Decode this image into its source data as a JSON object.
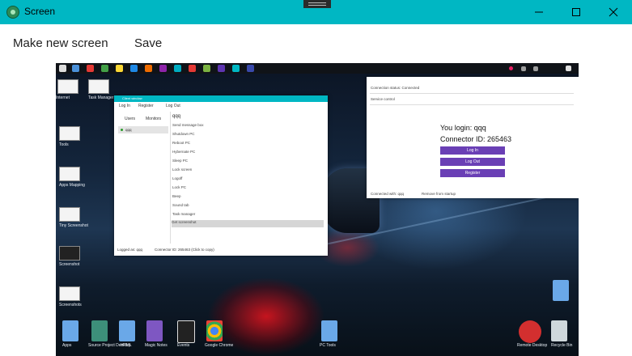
{
  "window": {
    "title": "Screen",
    "accent": "#00b7c3",
    "controls": [
      "minimize-icon",
      "maximize-icon",
      "close-icon"
    ]
  },
  "menu": {
    "make_new_screen": "Make new screen",
    "save": "Save"
  },
  "screenshot": {
    "client_window": {
      "title": "Client window",
      "menu": [
        "Log In",
        "Register",
        "Log Out"
      ],
      "tabs": [
        "Users",
        "Monitors"
      ],
      "users": [
        "qqq"
      ],
      "selected_user": "qqq",
      "commands": [
        "Send message box",
        "Shutdown PC",
        "Reboot PC",
        "Hybernate PC",
        "Sleep PC",
        "Lock screen",
        "Logoff",
        "Lock PC",
        "Beep",
        "Sound tab",
        "Task manager",
        "Get screenshot"
      ],
      "status_left": "Logged as: qqq",
      "status_right": "Connector ID: 265463 (Click to copy)"
    },
    "server_window": {
      "header": "Connection status: Connected",
      "section_label": "Service control",
      "login_text": "You login: qqq",
      "connector_text": "Connector ID: 265463",
      "buttons": [
        "Log In",
        "Log Out",
        "Register"
      ],
      "footer_left": "Connected with: qqq",
      "footer_right": "Remove from startup"
    },
    "desktop_icons_left": [
      "Internet",
      "Task Manager",
      "Tools",
      "Apps Mapping",
      "Tiny Screenshot",
      "Screenshot",
      "Screenshots"
    ],
    "desktop_icons_bottom": [
      "Apps",
      "Source Project Desktop",
      "HTML",
      "Magic Notes",
      "Events",
      "Google Chrome",
      "PC Tools",
      "Remote Desktop",
      "Recycle Bin"
    ]
  }
}
